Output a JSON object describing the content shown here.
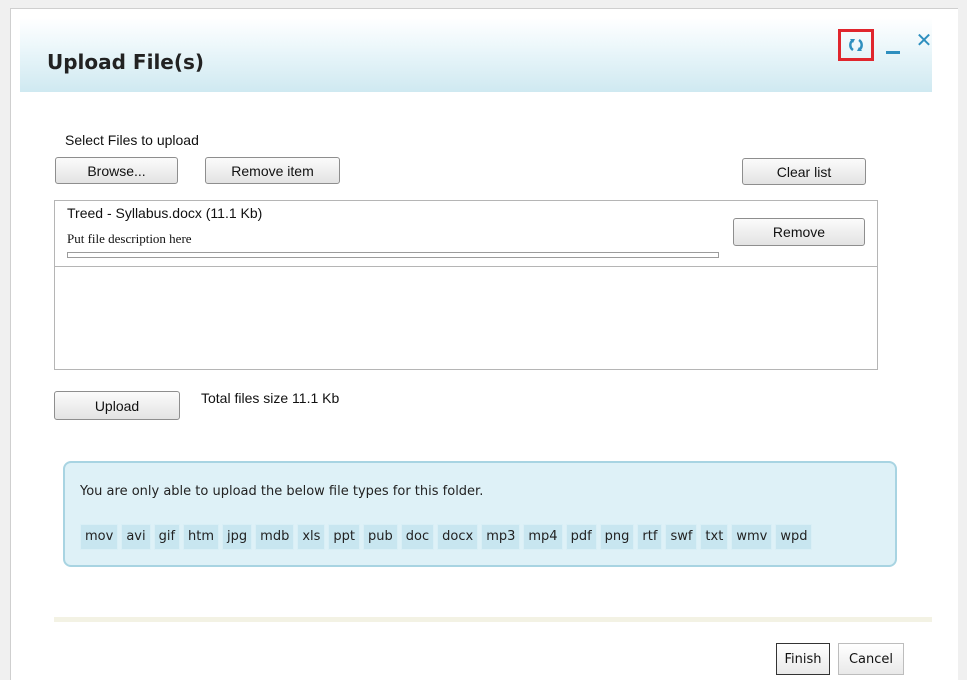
{
  "dialog": {
    "title": "Upload File(s)",
    "controls": [
      "refresh-icon",
      "minimize-icon",
      "close-icon"
    ],
    "accent_color": "#2e8fbf",
    "highlight_color": "#e0262d"
  },
  "select_label": "Select Files to upload",
  "buttons": {
    "browse": "Browse...",
    "remove_item": "Remove item",
    "clear_list": "Clear list",
    "remove": "Remove",
    "upload": "Upload",
    "finish": "Finish",
    "cancel": "Cancel"
  },
  "file": {
    "name": "Treed - Syllabus.docx (11.1 Kb)",
    "description": "Put file description here",
    "progress": 0
  },
  "total_size": "Total files size 11.1 Kb",
  "info": {
    "text": "You are only able to upload the below file types for this folder.",
    "file_types": [
      "mov",
      "avi",
      "gif",
      "htm",
      "jpg",
      "mdb",
      "xls",
      "ppt",
      "pub",
      "doc",
      "docx",
      "mp3",
      "mp4",
      "pdf",
      "png",
      "rtf",
      "swf",
      "txt",
      "wmv",
      "wpd"
    ]
  }
}
